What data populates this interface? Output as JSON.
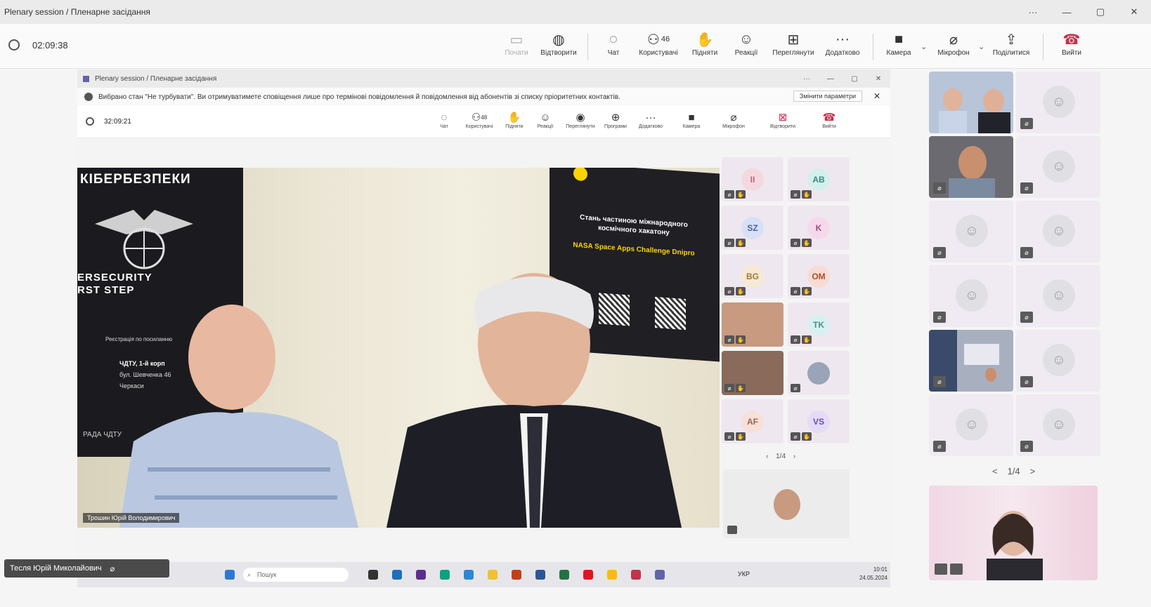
{
  "window": {
    "title": "Plenary session / Пленарне засідання",
    "controls": [
      "···",
      "—",
      "▢",
      "✕"
    ]
  },
  "toolbar": {
    "timer": "02:09:38",
    "buttons": [
      {
        "label": "Почати",
        "icon": "screen-share-icon"
      },
      {
        "label": "Відтворити",
        "icon": "recording-icon"
      },
      {
        "label": "Чат",
        "icon": "chat-icon"
      },
      {
        "label": "Користувачі",
        "icon": "people-icon",
        "count": "46"
      },
      {
        "label": "Підняти",
        "icon": "raise-hand-icon"
      },
      {
        "label": "Реакції",
        "icon": "reactions-icon"
      },
      {
        "label": "Переглянути",
        "icon": "view-icon"
      },
      {
        "label": "Додатково",
        "icon": "more-icon"
      },
      {
        "label": "Камера",
        "icon": "camera-icon"
      },
      {
        "label": "Мікрофон",
        "icon": "mic-muted-icon"
      },
      {
        "label": "Поділитися",
        "icon": "share-icon"
      },
      {
        "label": "Вийти",
        "icon": "hangup-icon"
      }
    ]
  },
  "inner_window": {
    "title": "Plenary session / Пленарне засідання",
    "notice": "Вибрано стан \"Не турбувати\". Ви отримуватимете сповіщення лише про термінові повідомлення й повідомлення від абонентів зі списку пріоритетних контактів.",
    "notice_button": "Змінити параметри",
    "timer": "32:09:21",
    "buttons": [
      {
        "label": "Чат"
      },
      {
        "label": "Користувачі",
        "count": "48"
      },
      {
        "label": "Підняти"
      },
      {
        "label": "Реакції"
      },
      {
        "label": "Переглянути"
      },
      {
        "label": "Програми"
      },
      {
        "label": "Додатково"
      },
      {
        "label": "Камера"
      },
      {
        "label": "Мікрофон"
      },
      {
        "label": "Відтворити"
      },
      {
        "label": "Вийти"
      }
    ],
    "video": {
      "banner_title": "КІБЕРБЕЗПЕКИ",
      "banner_line1": "ERSECURITY",
      "banner_line2": "RST STEP",
      "banner_reg": "Реєстрація по посиланню",
      "banner_addr1": "ЧДТУ, 1-й корп",
      "banner_addr2": "бул. Шевченка 46",
      "banner_addr3": "Черкаси",
      "banner_foot": "РАДА ЧДТУ",
      "poster_title": "Стань частиною міжнародного космічного хакатону",
      "poster_event": "NASA Space Apps Challenge Dnipro",
      "speaker_tag": "Трошин Юрій Володимирович"
    },
    "participants": [
      {
        "initials": "II",
        "color": "#e8a0b4"
      },
      {
        "initials": "AB",
        "color": "#9bd0c8"
      },
      {
        "initials": "SZ",
        "color": "#a0b4e8"
      },
      {
        "initials": "K",
        "color": "#e8a0d0"
      },
      {
        "initials": "BG",
        "color": "#e8d0a0"
      },
      {
        "initials": "OM",
        "color": "#e8b0a0"
      },
      {
        "initials": "",
        "color": "#c89a80"
      },
      {
        "initials": "TK",
        "color": "#a8d8d8"
      },
      {
        "initials": "",
        "color": "#8a6a5a"
      },
      {
        "initials": "",
        "color": "#d0d0d8"
      },
      {
        "initials": "AF",
        "color": "#e8b8a8"
      },
      {
        "initials": "VS",
        "color": "#c0b0e0"
      }
    ],
    "pager": "1/4",
    "taskbar_search": "Пошук",
    "clock_time": "10:01",
    "clock_date": "24.05.2024",
    "taskbar_tray": "УКР"
  },
  "lower_name_tag": "Тесля Юрій Миколайович",
  "right_panel": {
    "pager": "1/4",
    "prev": "<",
    "next": ">"
  },
  "colors": {
    "accent": "#6264a7",
    "leave": "#c4314b",
    "tile_bg": "#f0eaf2"
  }
}
